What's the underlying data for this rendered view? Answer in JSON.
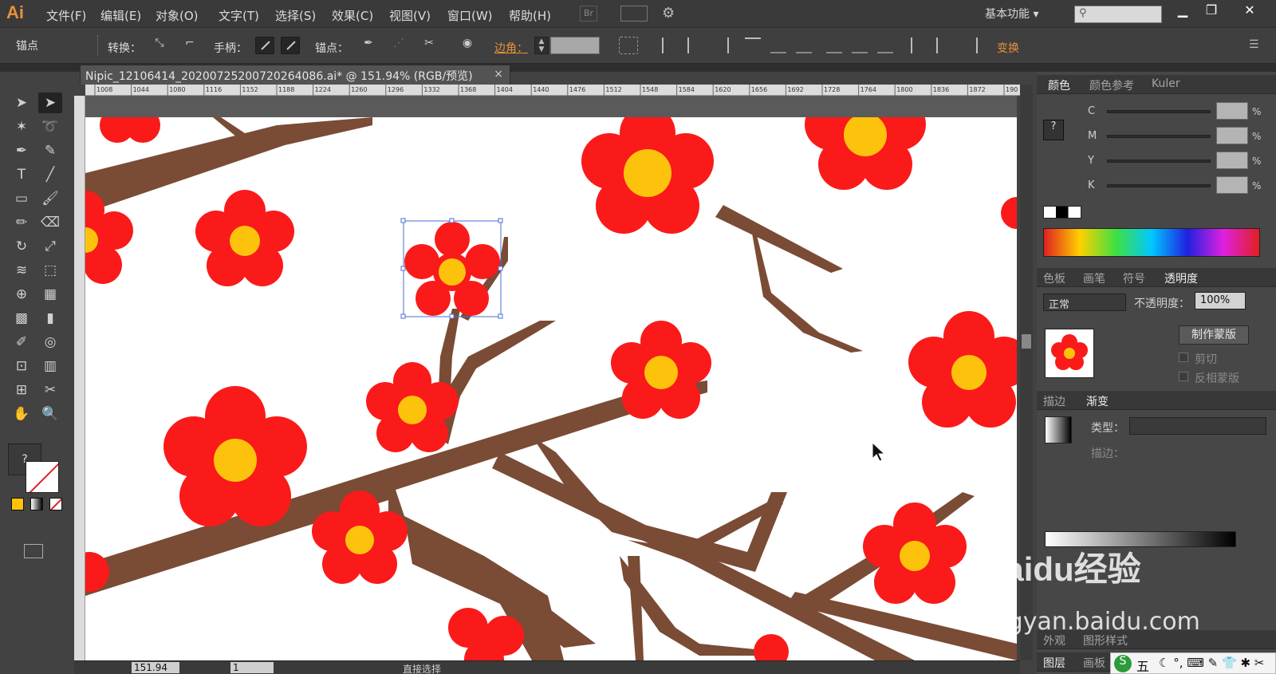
{
  "app": {
    "logo": "Ai",
    "bridge": "Br",
    "workspace": "基本功能"
  },
  "menus": [
    "文件(F)",
    "编辑(E)",
    "对象(O)",
    "文字(T)",
    "选择(S)",
    "效果(C)",
    "视图(V)",
    "窗口(W)",
    "帮助(H)"
  ],
  "control_bar": {
    "tool_name": "锚点",
    "convert_label": "转换：",
    "handles_label": "手柄：",
    "anchors_label": "锚点：",
    "corner_label": "边角：",
    "transform_label": "变换"
  },
  "document": {
    "tab_title": "Nipic_12106414_20200725200720264086.ai* @ 151.94% (RGB/预览)",
    "close": "×"
  },
  "ruler": {
    "top_ticks": [
      "1008",
      "1044",
      "1080",
      "1116",
      "1152",
      "1188",
      "1224",
      "1260",
      "1296",
      "1332",
      "1368",
      "1404",
      "1440",
      "1476",
      "1512",
      "1548",
      "1584",
      "1620",
      "1656",
      "1692",
      "1728",
      "1764",
      "1800",
      "1836",
      "1872",
      "190"
    ]
  },
  "status": {
    "zoom": "151.94",
    "artboard": "1",
    "tool": "直接选择"
  },
  "color_panel": {
    "tabs": [
      "颜色",
      "颜色参考",
      "Kuler"
    ],
    "channels": [
      "C",
      "M",
      "Y",
      "K"
    ],
    "percent": "%"
  },
  "transparency_panel": {
    "tabs": [
      "色板",
      "画笔",
      "符号",
      "透明度"
    ],
    "mode": "正常",
    "opacity_label": "不透明度：",
    "opacity": "100%",
    "make_mask": "制作蒙版",
    "clip": "剪切",
    "invert": "反相蒙版"
  },
  "gradient_panel": {
    "tabs": [
      "描边",
      "渐变"
    ],
    "type_label": "类型：",
    "stroke_label": "描边："
  },
  "appearance_panel": {
    "tabs": [
      "外观",
      "图形样式"
    ]
  },
  "layers_panel": {
    "tabs": [
      "图层",
      "画板"
    ]
  },
  "watermark": {
    "brand": "Baidu经验",
    "url": "jingyan.baidu.com"
  },
  "taskbar": {
    "ime": "五"
  },
  "colors": {
    "accent": "#e8913a",
    "flower_red": "#fa1a1a",
    "flower_center": "#fdc30c",
    "branch": "#7a4b35",
    "selection": "#4a6ed6"
  }
}
